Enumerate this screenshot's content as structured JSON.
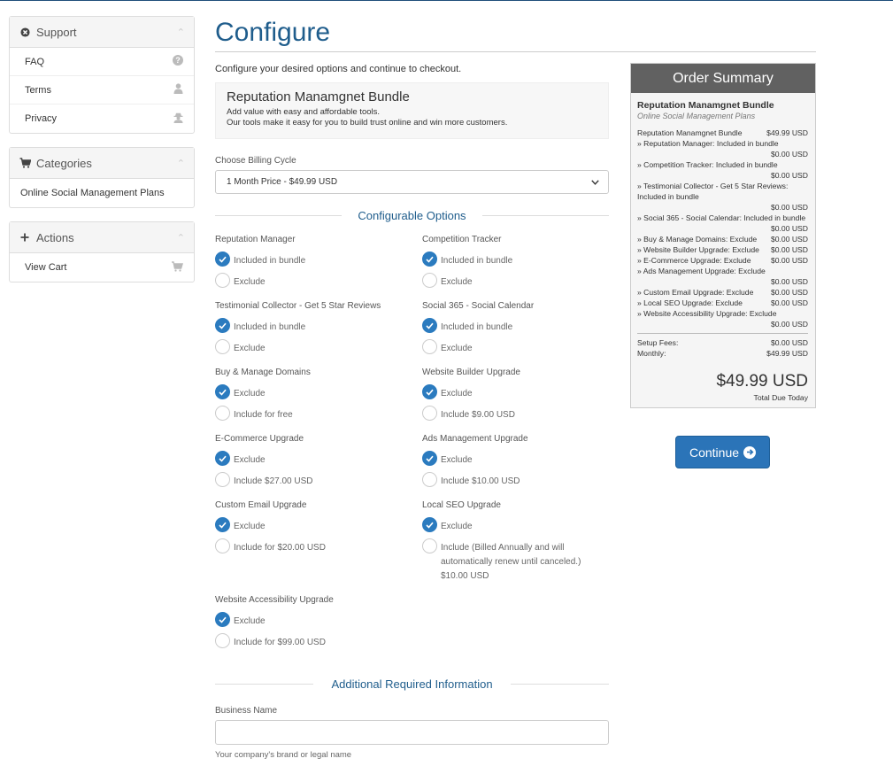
{
  "sidebar": {
    "support": {
      "title": "Support",
      "items": [
        {
          "label": "FAQ",
          "icon": "question-icon"
        },
        {
          "label": "Terms",
          "icon": "user-icon"
        },
        {
          "label": "Privacy",
          "icon": "user-secret-icon"
        }
      ]
    },
    "categories": {
      "title": "Categories",
      "items": [
        {
          "label": "Online Social Management Plans"
        }
      ]
    },
    "actions": {
      "title": "Actions",
      "items": [
        {
          "label": "View Cart",
          "icon": "cart-icon"
        }
      ]
    }
  },
  "main": {
    "title": "Configure",
    "intro": "Configure your desired options and continue to checkout.",
    "bundle": {
      "name": "Reputation Manamgnet Bundle",
      "line1": "Add value with easy and affordable tools.",
      "line2": "Our tools make it easy for you to build trust online and win more customers."
    },
    "billing": {
      "label": "Choose Billing Cycle",
      "selected": "1 Month Price - $49.99 USD"
    },
    "configurable_heading": "Configurable Options",
    "options": [
      {
        "label": "Reputation Manager",
        "choices": [
          "Included in bundle",
          "Exclude"
        ],
        "selected": 0
      },
      {
        "label": "Competition Tracker",
        "choices": [
          "Included in bundle",
          "Exclude"
        ],
        "selected": 0
      },
      {
        "label": "Testimonial Collector - Get 5 Star Reviews",
        "choices": [
          "Included in bundle",
          "Exclude"
        ],
        "selected": 0
      },
      {
        "label": "Social 365 - Social Calendar",
        "choices": [
          "Included in bundle",
          "Exclude"
        ],
        "selected": 0
      },
      {
        "label": "Buy & Manage Domains",
        "choices": [
          "Exclude",
          "Include for free"
        ],
        "selected": 0
      },
      {
        "label": "Website Builder Upgrade",
        "choices": [
          "Exclude",
          "Include $9.00 USD"
        ],
        "selected": 0
      },
      {
        "label": "E-Commerce Upgrade",
        "choices": [
          "Exclude",
          "Include $27.00 USD"
        ],
        "selected": 0
      },
      {
        "label": "Ads Management Upgrade",
        "choices": [
          "Exclude",
          "Include $10.00 USD"
        ],
        "selected": 0
      },
      {
        "label": "Custom Email Upgrade",
        "choices": [
          "Exclude",
          "Include for $20.00 USD"
        ],
        "selected": 0
      },
      {
        "label": "Local SEO Upgrade",
        "choices": [
          "Exclude",
          "Include (Billed Annually and will automatically renew until canceled.) $10.00 USD"
        ],
        "selected": 0
      },
      {
        "label": "Website Accessibility Upgrade",
        "choices": [
          "Exclude",
          "Include for $99.00 USD"
        ],
        "selected": 0
      }
    ],
    "additional_heading": "Additional Required Information",
    "business_name": {
      "label": "Business Name",
      "value": "",
      "help": "Your company's brand or legal name"
    }
  },
  "summary": {
    "heading": "Order Summary",
    "product": "Reputation Manamgnet Bundle",
    "group": "Online Social Management Plans",
    "base_label": "Reputation Manamgnet Bundle",
    "base_price": "$49.99 USD",
    "lines": [
      {
        "label": "» Reputation Manager: Included in bundle",
        "price": "$0.00 USD",
        "wrap": true
      },
      {
        "label": "» Competition Tracker: Included in bundle",
        "price": "$0.00 USD",
        "wrap": true
      },
      {
        "label": "» Testimonial Collector - Get 5 Star Reviews: Included in bundle",
        "price": "$0.00 USD",
        "wrap": true
      },
      {
        "label": "» Social 365 - Social Calendar: Included in bundle",
        "price": "$0.00 USD",
        "wrap": true
      },
      {
        "label": "» Buy & Manage Domains: Exclude",
        "price": "$0.00 USD",
        "wrap": false
      },
      {
        "label": "» Website Builder Upgrade: Exclude",
        "price": "$0.00 USD",
        "wrap": false
      },
      {
        "label": "» E-Commerce Upgrade: Exclude",
        "price": "$0.00 USD",
        "wrap": false
      },
      {
        "label": "» Ads Management Upgrade: Exclude",
        "price": "$0.00 USD",
        "wrap": true
      },
      {
        "label": "» Custom Email Upgrade: Exclude",
        "price": "$0.00 USD",
        "wrap": false
      },
      {
        "label": "» Local SEO Upgrade: Exclude",
        "price": "$0.00 USD",
        "wrap": false
      },
      {
        "label": "» Website Accessibility Upgrade: Exclude",
        "price": "$0.00 USD",
        "wrap": true
      }
    ],
    "setup_label": "Setup Fees:",
    "setup_value": "$0.00 USD",
    "monthly_label": "Monthly:",
    "monthly_value": "$49.99 USD",
    "total": "$49.99 USD",
    "total_label": "Total Due Today"
  },
  "continue_label": "Continue",
  "colors": {
    "accent": "#2b7bbf",
    "title": "#1f5d8c",
    "summary_header": "#616161"
  }
}
